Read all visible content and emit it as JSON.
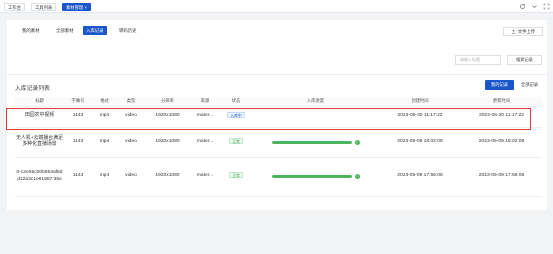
{
  "topbar": {
    "tabs": [
      {
        "label": "工作台"
      },
      {
        "label": "工具列表"
      },
      {
        "label": "素材管理 ×"
      }
    ]
  },
  "subtabs": [
    {
      "label": "我的素材"
    },
    {
      "label": "全部素材"
    },
    {
      "label": "入库记录"
    },
    {
      "label": "转码历史"
    }
  ],
  "upload_label": "文件上传",
  "search": {
    "placeholder": "请输入标题",
    "button": "搜索记录"
  },
  "list": {
    "title": "入库记录列表",
    "btn_mine": "我的记录",
    "btn_all": "全部记录",
    "columns": [
      "标题",
      "字幕号",
      "格式",
      "类型",
      "分辨率",
      "来源",
      "状态",
      "入库进度",
      "创建时间",
      "更新时间"
    ],
    "rows": [
      {
        "title": "田园农中视频",
        "sub": "1143",
        "format": "mp4",
        "type": "video",
        "res": "1920x1080",
        "source": "mater...",
        "status": "入库中",
        "progress": 0,
        "created": "2023-05-30 11:17:22",
        "updated": "2023-05-30 11:17:22"
      },
      {
        "title": "无人机+云端播台满足多种化直播场景",
        "sub": "1143",
        "format": "mp4",
        "type": "video",
        "res": "1920x1080",
        "source": "mater...",
        "status": "正常",
        "progress": 100,
        "created": "2023-05-09 18:02:08",
        "updated": "2023-05-09 18:02:08"
      },
      {
        "title": "0-c2e55c00b654af8dd12a3c1e61957 35e",
        "sub": "1143",
        "format": "mp4",
        "type": "video",
        "res": "1920x1080",
        "source": "mater...",
        "status": "正常",
        "progress": 100,
        "created": "2023-05-09 17:56:08",
        "updated": "2023-05-09 17:56:08"
      }
    ]
  },
  "colors": {
    "accent": "#1a56c9",
    "success": "#4bb45e",
    "highlight": "#e23b3b"
  }
}
